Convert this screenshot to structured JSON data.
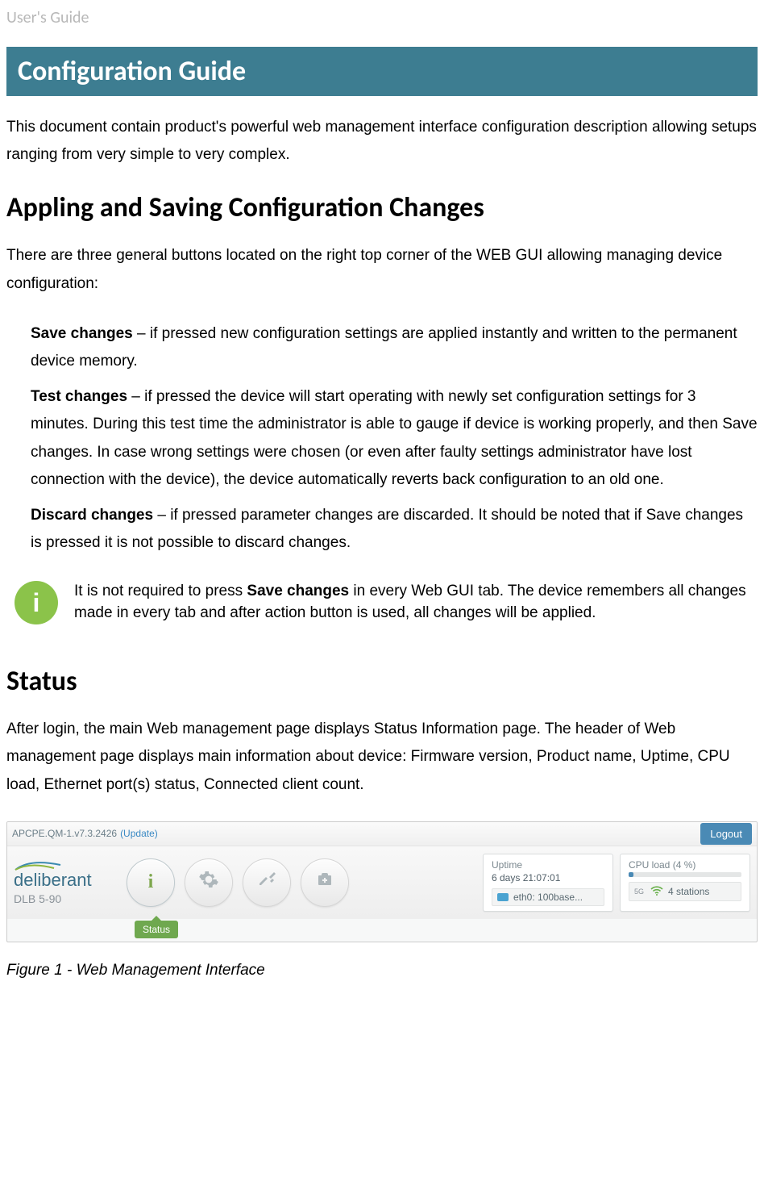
{
  "header_label": "User's Guide",
  "banner_title": "Configuration Guide",
  "intro": "This document contain product's powerful web management interface configuration description allowing setups ranging from very simple to very complex.",
  "h2_apply": "Appling and Saving Configuration Changes",
  "apply_intro": "There are three general buttons located on the right top corner of the WEB GUI allowing managing device configuration:",
  "items": [
    {
      "lead": "Save changes",
      "body": " – if pressed new configuration settings are applied instantly and written to the permanent device memory."
    },
    {
      "lead": "Test changes",
      "body": " – if pressed the device will start operating with newly set configuration settings for 3 minutes. During this test time the administrator is able to gauge if device is working properly, and then Save changes. In case wrong settings were chosen (or even after faulty settings administrator have lost connection with the device), the device automatically reverts back configuration to an old one."
    },
    {
      "lead": "Discard changes",
      "body": " – if pressed parameter changes are discarded. It should be noted that if Save changes is pressed it is not possible to discard changes."
    }
  ],
  "info_icon": "i",
  "info_pre": "It is not required to press ",
  "info_bold": "Save changes",
  "info_post": " in every Web GUI tab. The device remembers all changes made in every tab and after action button is used, all changes will be applied.",
  "h2_status": "Status",
  "status_body": "After login, the main Web management page displays Status Information page. The header of Web management page displays main information about device: Firmware version, Product name, Uptime, CPU load, Ethernet port(s) status, Connected client count.",
  "ss": {
    "fw": "APCPE.QM-1.v7.3.2426",
    "update": "(Update)",
    "logout": "Logout",
    "brand": "deliberant",
    "model": "DLB 5-90",
    "status_tag": "Status",
    "uptime_label": "Uptime",
    "uptime_val": "6 days 21:07:01",
    "eth": "eth0: 100base...",
    "cpu_label": "CPU load (4 %)",
    "stations": "4 stations",
    "five_g": "5G"
  },
  "fig_caption": "Figure 1 - Web Management Interface"
}
